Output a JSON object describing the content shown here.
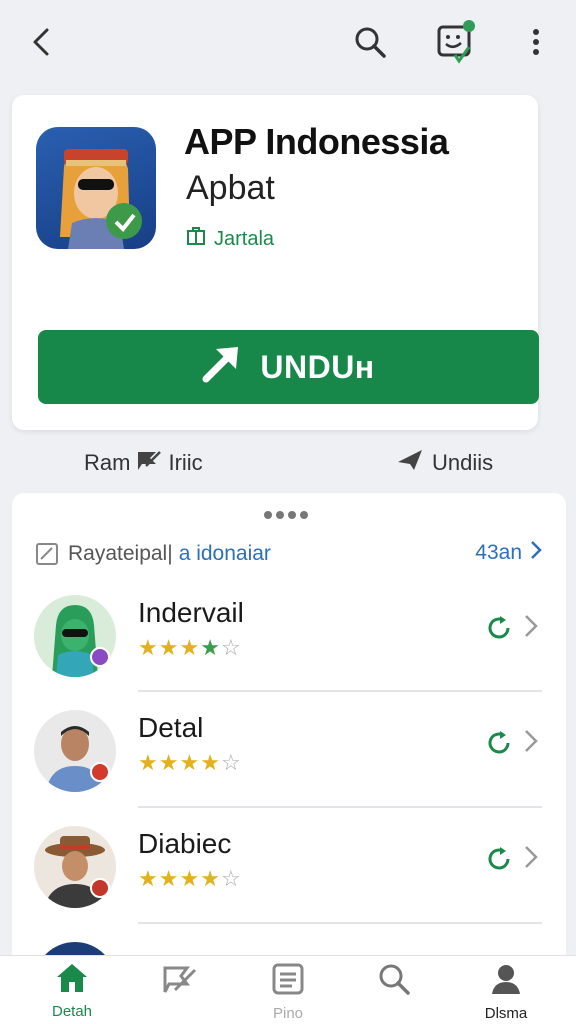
{
  "topbar": {
    "back_icon": "back-arrow-icon",
    "search_icon": "search-icon",
    "app_icon": "app-sticker-icon",
    "more_icon": "more-vertical-icon"
  },
  "app": {
    "title": "APP Indonessia",
    "subtitle": "Apbat",
    "meta_label": "Jartala",
    "download_label": "UNDUн",
    "accent_color": "#17884a"
  },
  "meta_row": {
    "left_label": "Ram",
    "left_label_2": "Iriic",
    "right_label": "Undiis"
  },
  "list": {
    "header_title": "Rayateipal|",
    "header_link": "a idonaiar",
    "header_count": "43an",
    "items": [
      {
        "name": "Indervail",
        "rating": 4,
        "max": 5
      },
      {
        "name": "Detal",
        "rating": 4,
        "max": 5
      },
      {
        "name": "Diabiec",
        "rating": 4,
        "max": 5
      }
    ]
  },
  "bottom_nav": {
    "items": [
      {
        "label": "Detah",
        "active": true
      },
      {
        "label": "",
        "active": false
      },
      {
        "label": "Pino",
        "active": false
      },
      {
        "label": "",
        "active": false
      },
      {
        "label": "Dlsma",
        "active": false
      }
    ]
  }
}
